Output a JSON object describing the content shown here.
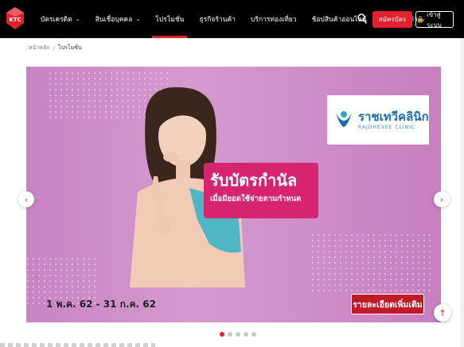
{
  "brand": {
    "logo_text": "KTC",
    "accent": "#e3212e"
  },
  "nav": {
    "items": [
      {
        "label": "บัตรเครดิต",
        "has_dropdown": true,
        "active": false
      },
      {
        "label": "สินเชื่อบุคคล",
        "has_dropdown": true,
        "active": false
      },
      {
        "label": "โปรโมชั่น",
        "has_dropdown": false,
        "active": true
      },
      {
        "label": "ธุรกิจร้านค้า",
        "has_dropdown": false,
        "active": false
      },
      {
        "label": "บริการท่องเที่ยว",
        "has_dropdown": false,
        "active": false
      },
      {
        "label": "ช้อปสินค้าออนไลน์",
        "has_dropdown": false,
        "active": false
      },
      {
        "label": "บริการลูกค้า",
        "has_dropdown": true,
        "active": false
      }
    ],
    "apply_label": "สมัครบัตร",
    "login_label": "เข้าสู่ระบบ"
  },
  "breadcrumb": {
    "home": "หน้าหลัก",
    "separator": "/",
    "current": "โปรโมชั่น"
  },
  "banner": {
    "partner_name_th": "ราชเทวีคลินิก",
    "partner_name_en": "RAJDHEVEE CLINIC",
    "promo_title": "รับบัตรกำนัล",
    "promo_subtitle": "เมื่อมียอดใช้จ่ายตามกำหนด",
    "date_range": "1 พ.ค. 62 - 31 ก.ค. 62",
    "more_label": "รายละเอียดเพิ่มเติม",
    "slide_count": 5,
    "active_slide": 1
  },
  "icons": {
    "search": "search-icon",
    "prev": "chevron-left-icon",
    "next": "chevron-right-icon",
    "scroll_top": "arrow-up-icon",
    "lock": "lock-icon"
  }
}
